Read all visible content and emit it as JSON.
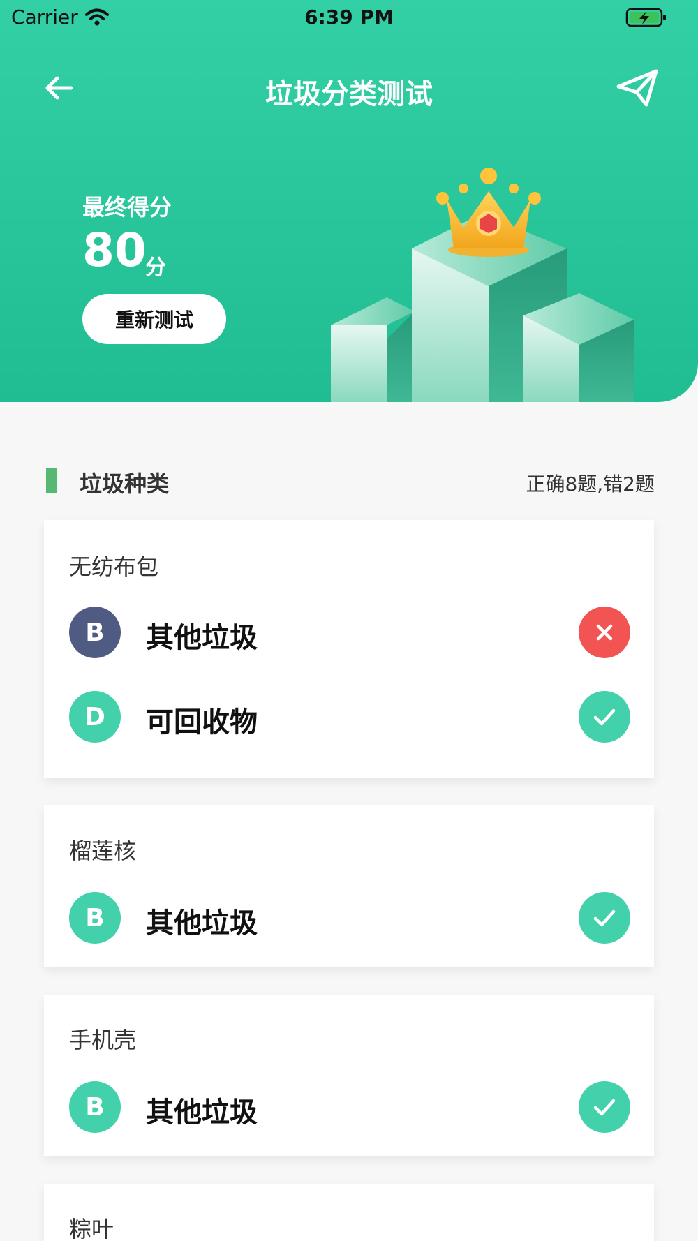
{
  "status_bar": {
    "carrier": "Carrier",
    "time": "6:39 PM"
  },
  "nav": {
    "title": "垃圾分类测试"
  },
  "score": {
    "label": "最终得分",
    "value": "80",
    "unit": "分",
    "retest_label": "重新测试"
  },
  "section": {
    "title": "垃圾种类",
    "summary": "正确8题,错2题"
  },
  "colors": {
    "primary": "#2ecba1",
    "wrong": "#f25454",
    "wrong_badge": "#4f5b82",
    "section_bar": "#56b873"
  },
  "questions": [
    {
      "item": "无纺布包",
      "answers": [
        {
          "letter": "B",
          "text": "其他垃圾",
          "correct": false
        },
        {
          "letter": "D",
          "text": "可回收物",
          "correct": true
        }
      ]
    },
    {
      "item": "榴莲核",
      "answers": [
        {
          "letter": "B",
          "text": "其他垃圾",
          "correct": true
        }
      ]
    },
    {
      "item": "手机壳",
      "answers": [
        {
          "letter": "B",
          "text": "其他垃圾",
          "correct": true
        }
      ]
    },
    {
      "item": "粽叶",
      "answers": []
    }
  ]
}
